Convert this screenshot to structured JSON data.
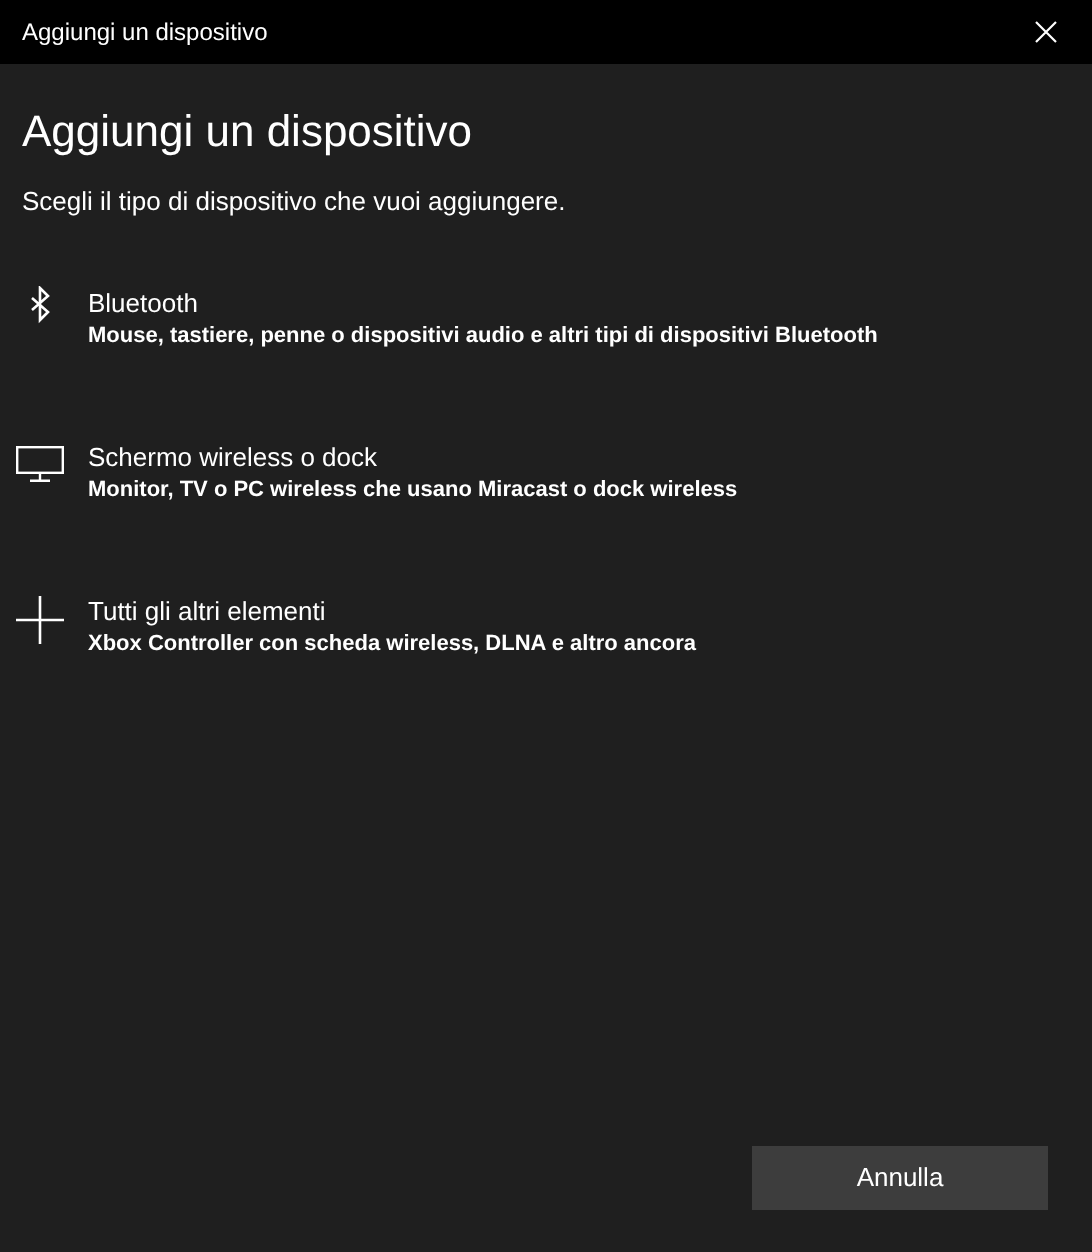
{
  "window": {
    "title": "Aggiungi un dispositivo"
  },
  "heading": "Aggiungi un dispositivo",
  "subtitle": "Scegli il tipo di dispositivo che vuoi aggiungere.",
  "options": [
    {
      "kind": "bluetooth",
      "title": "Bluetooth",
      "description": "Mouse, tastiere, penne o dispositivi audio e altri tipi di dispositivi Bluetooth"
    },
    {
      "kind": "display",
      "title": "Schermo wireless o dock",
      "description": "Monitor, TV o PC wireless che usano Miracast o dock wireless"
    },
    {
      "kind": "plus",
      "title": "Tutti gli altri elementi",
      "description": "Xbox Controller con scheda wireless, DLNA e altro ancora"
    }
  ],
  "buttons": [
    {
      "label": "Annulla"
    }
  ]
}
